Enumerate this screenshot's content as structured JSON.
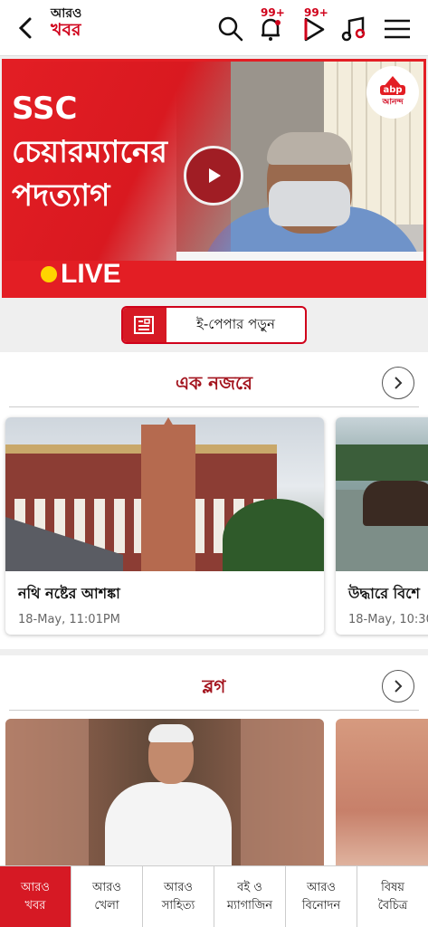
{
  "header": {
    "brand_line1": "আরও",
    "brand_line2": "খবর",
    "notifications_badge": "99+",
    "video_badge": "99+",
    "icons": [
      "back-arrow-icon",
      "search-icon",
      "bell-icon",
      "play-outline-icon",
      "music-note-icon",
      "menu-icon"
    ]
  },
  "hero": {
    "title_line1": "SSC",
    "title_line2": "চেয়ারম্যানের",
    "title_line3": "পদত্যাগ",
    "live_label": "LIVE",
    "logo_abp": "abp",
    "logo_anandha": "আনন্দ",
    "accent": "#e31e24"
  },
  "epaper": {
    "label": "ই-পেপার পড়ুন"
  },
  "sections": {
    "glance": {
      "title": "এক নজরে",
      "cards": [
        {
          "title": "নথি নষ্টের আশঙ্কা",
          "time": "18-May, 11:01PM"
        },
        {
          "title": "উদ্ধারে বিশে",
          "time": "18-May, 10:30P"
        }
      ]
    },
    "blog": {
      "title": "ব্লগ"
    }
  },
  "bottom_nav": [
    {
      "label": "আরও\nখবর",
      "active": true
    },
    {
      "label": "আরও\nখেলা",
      "active": false
    },
    {
      "label": "আরও\nসাহিত্য",
      "active": false
    },
    {
      "label": "বই ও\nম্যাগাজিন",
      "active": false
    },
    {
      "label": "আরও\nবিনোদন",
      "active": false
    },
    {
      "label": "বিষয়\nবৈচিত্র",
      "active": false
    }
  ]
}
